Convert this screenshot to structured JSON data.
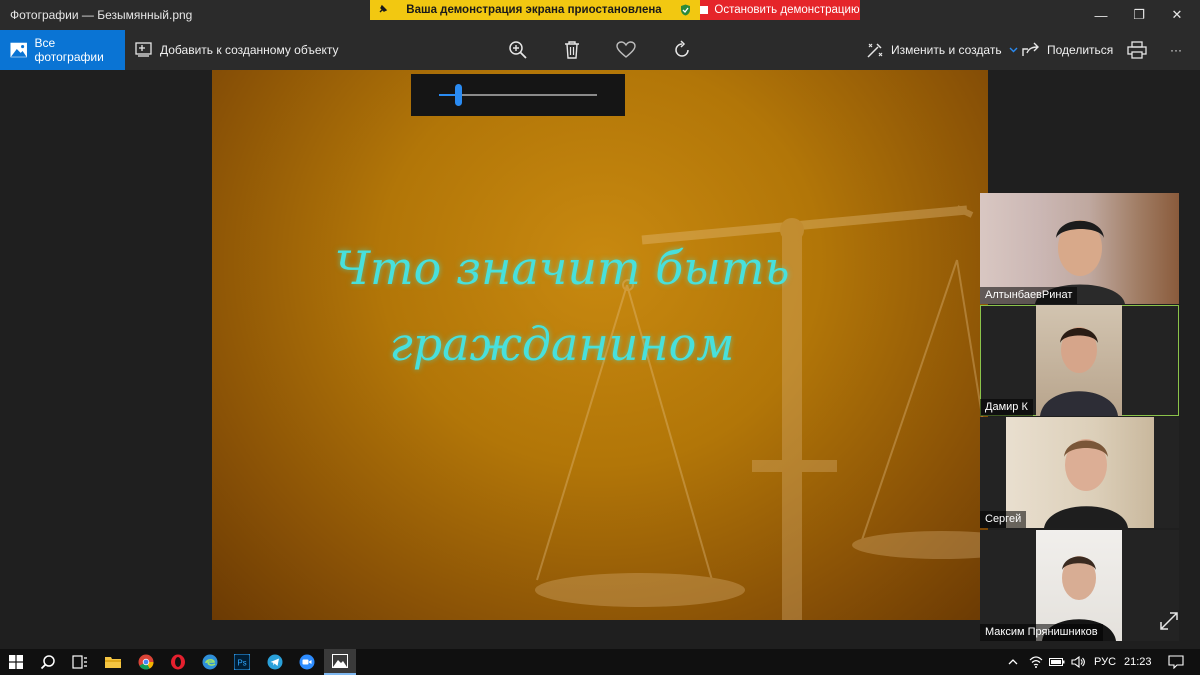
{
  "window": {
    "title": "Фотографии — Безымянный.png",
    "controls": {
      "minimize": "—",
      "maximize": "❐",
      "close": "✕"
    }
  },
  "share": {
    "status_text": "Ваша демонстрация экрана приостановлена",
    "stop_label": "Остановить демонстрацию",
    "status_color": "#f2c811",
    "stop_color": "#e5252a"
  },
  "toolbar": {
    "all_photos_label": "Все фотографии",
    "add_label": "Добавить к созданному объекту",
    "edit_label": "Изменить и создать",
    "share_label": "Поделиться",
    "more_label": "···",
    "accent": "#0a74d4"
  },
  "slide": {
    "title": "Что значит быть гражданином"
  },
  "zoom": {
    "level": 0.12
  },
  "participants": [
    {
      "name": "АлтынбаевРинат",
      "active": false
    },
    {
      "name": "Дамир К",
      "active": true
    },
    {
      "name": "Сергей",
      "active": false
    },
    {
      "name": "Максим Прянишников",
      "active": false
    }
  ],
  "taskbar": {
    "apps": [
      "start-icon",
      "search-icon",
      "task-view-icon",
      "file-explorer-icon",
      "chrome-icon",
      "opera-icon",
      "edge-icon",
      "photoshop-icon",
      "telegram-icon",
      "zoom-icon",
      "photos-icon"
    ],
    "photoshop_label": "Ps",
    "language": "РУС",
    "time": "21:23"
  }
}
